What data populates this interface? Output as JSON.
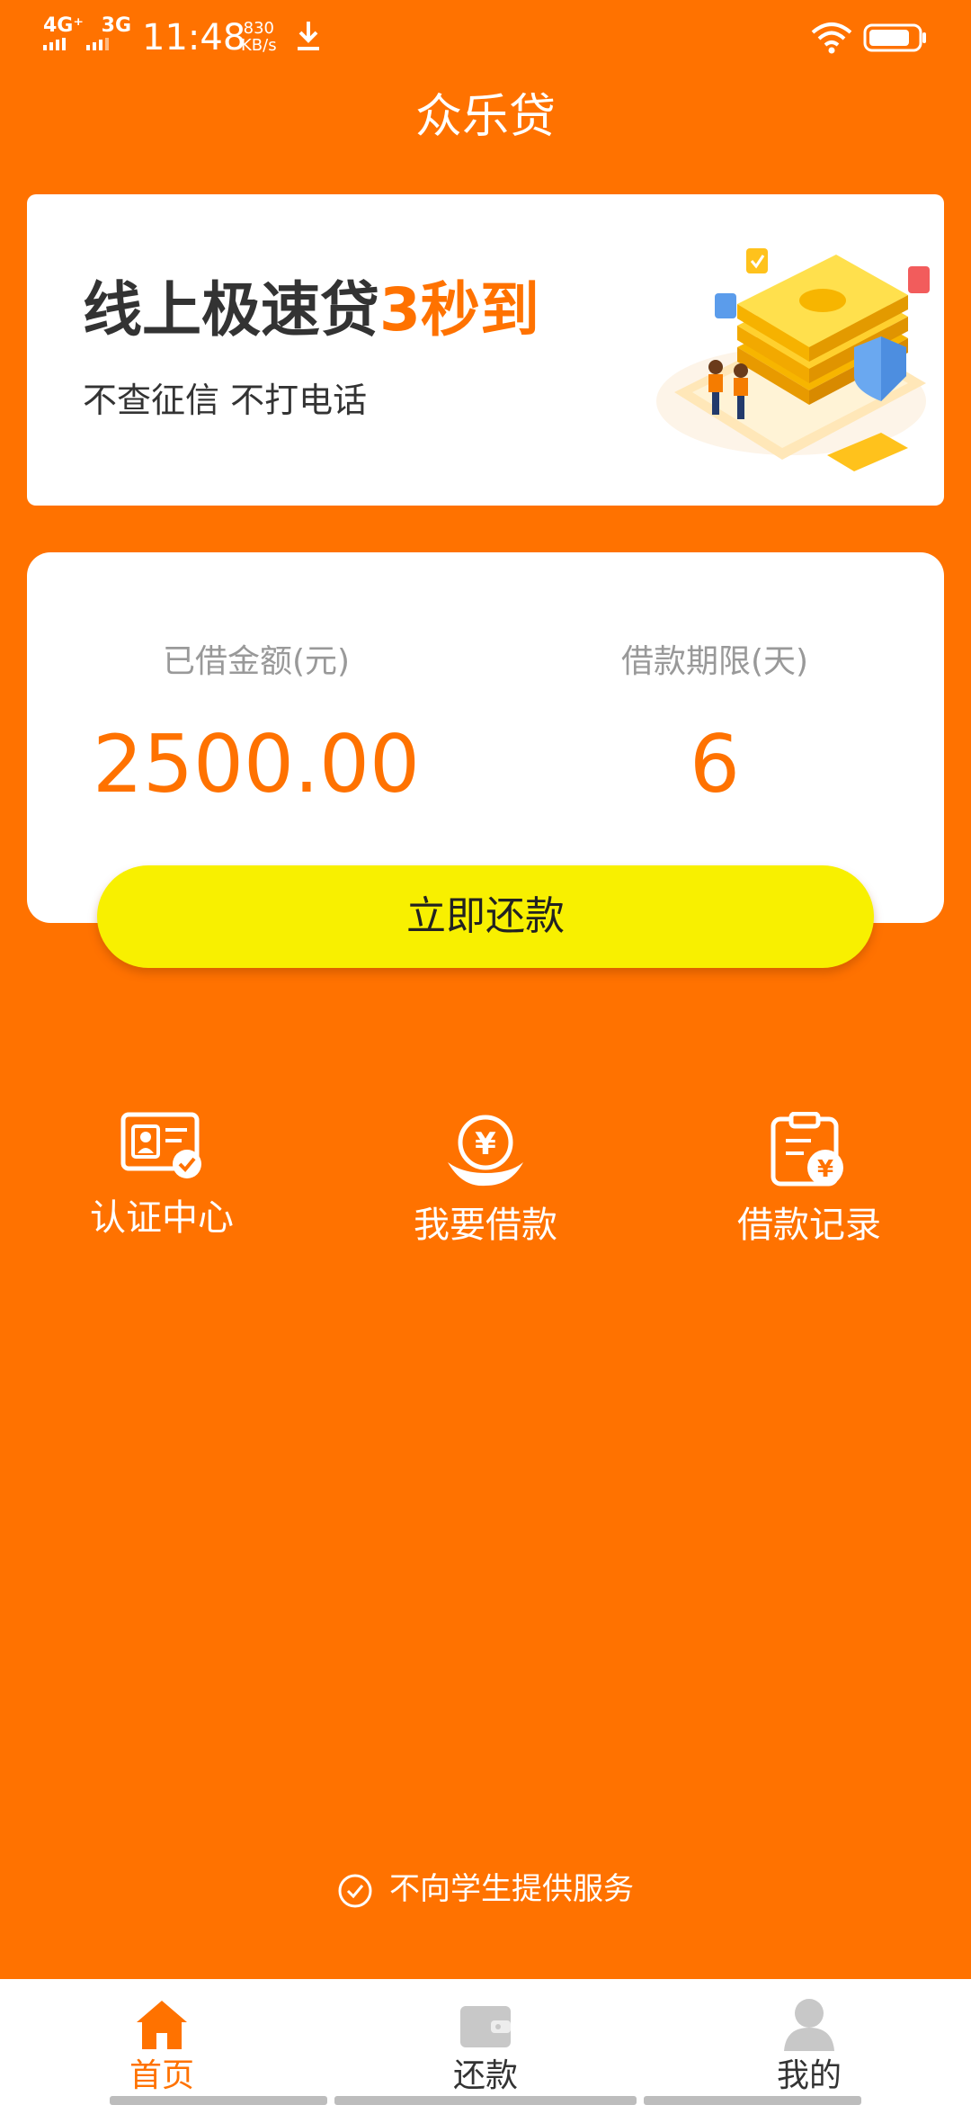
{
  "status_bar": {
    "network_1": "4G⁺",
    "network_2": "3G",
    "time": "11:48",
    "speed_value": "830",
    "speed_unit": "KB/s"
  },
  "header": {
    "title": "众乐贷"
  },
  "banner": {
    "headline": "线上极速贷",
    "headline_highlight": "3秒到",
    "subtitle": "不查征信 不打电话"
  },
  "loan_card": {
    "amount_label": "已借金额(元)",
    "amount_value": "2500.00",
    "term_label": "借款期限(天)",
    "term_value": "6",
    "repay_button": "立即还款"
  },
  "menu": {
    "items": [
      {
        "label": "认证中心",
        "icon": "id-card-check-icon"
      },
      {
        "label": "我要借款",
        "icon": "yuan-coin-hand-icon"
      },
      {
        "label": "借款记录",
        "icon": "clipboard-yuan-icon"
      }
    ]
  },
  "notice": {
    "text": "不向学生提供服务",
    "icon": "check-circle-icon"
  },
  "tab_bar": {
    "tabs": [
      {
        "label": "首页",
        "icon": "home-icon",
        "active": true
      },
      {
        "label": "还款",
        "icon": "wallet-icon",
        "active": false
      },
      {
        "label": "我的",
        "icon": "user-icon",
        "active": false
      }
    ]
  },
  "colors": {
    "primary": "#FF7200",
    "button": "#F8F000",
    "card_bg": "#FFFFFF",
    "label_gray": "#999999"
  }
}
